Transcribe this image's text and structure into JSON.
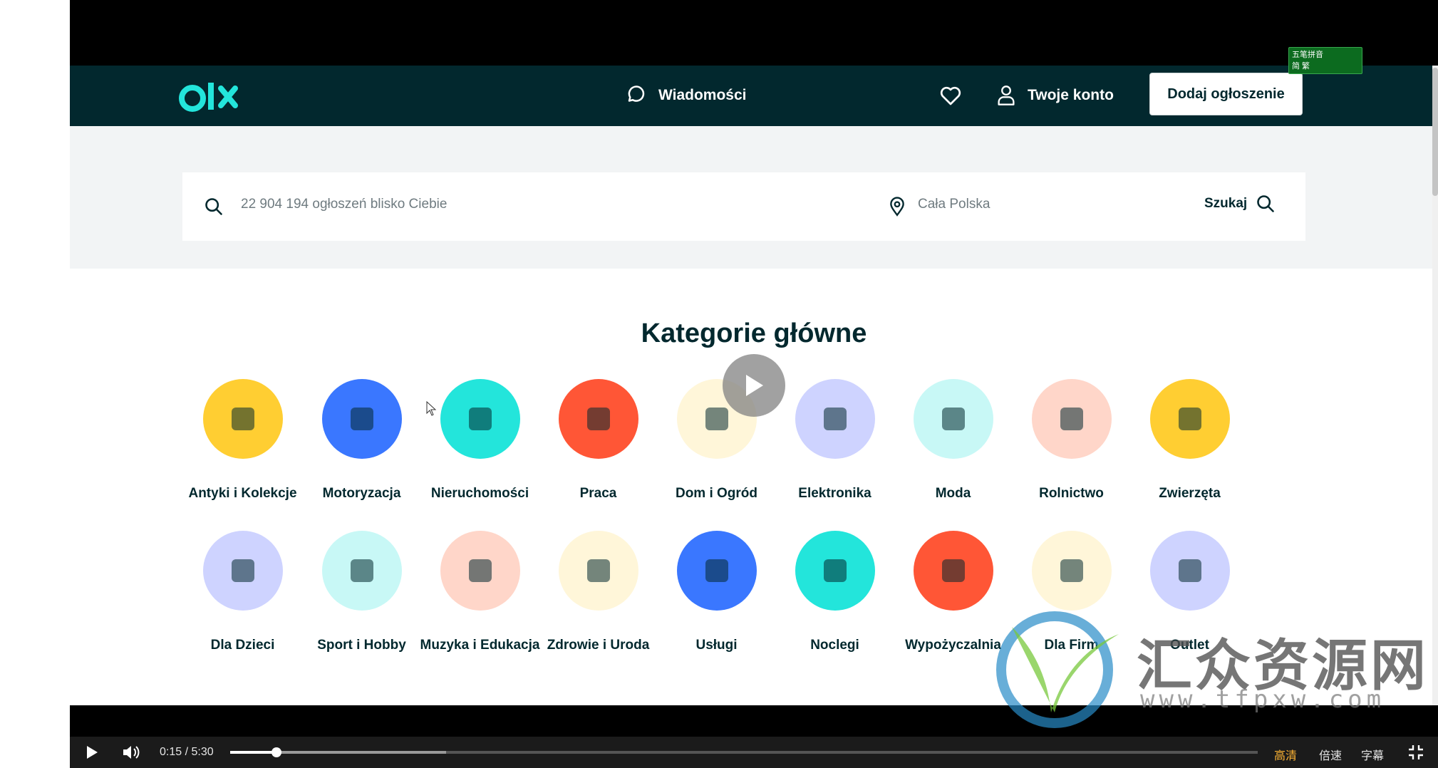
{
  "header": {
    "logo_text": "olx",
    "messages_label": "Wiadomości",
    "account_label": "Twoje konto",
    "add_listing_label": "Dodaj ogłoszenie"
  },
  "search": {
    "placeholder": "22 904 194 ogłoszeń blisko Ciebie",
    "location_placeholder": "Cała Polska",
    "button_label": "Szukaj"
  },
  "categories_title": "Kategorie główne",
  "categories": [
    {
      "label": "Antyki i Kolekcje",
      "icon": "pocket-watch-icon",
      "color": "#ffce32"
    },
    {
      "label": "Motoryzacja",
      "icon": "car-icon",
      "color": "#3a77ff"
    },
    {
      "label": "Nieruchomości",
      "icon": "key-icon",
      "color": "#23e5db"
    },
    {
      "label": "Praca",
      "icon": "briefcase-icon",
      "color": "#ff5636"
    },
    {
      "label": "Dom i Ogród",
      "icon": "chair-icon",
      "color": "#fff6d9"
    },
    {
      "label": "Elektronika",
      "icon": "phone-icon",
      "color": "#ced3ff"
    },
    {
      "label": "Moda",
      "icon": "dress-icon",
      "color": "#c8f8f6"
    },
    {
      "label": "Rolnictwo",
      "icon": "tractor-icon",
      "color": "#ffd6c9"
    },
    {
      "label": "Zwierzęta",
      "icon": "dog-icon",
      "color": "#ffce32"
    },
    {
      "label": "Dla Dzieci",
      "icon": "stroller-icon",
      "color": "#ced3ff"
    },
    {
      "label": "Sport i Hobby",
      "icon": "ball-icon",
      "color": "#c8f8f6"
    },
    {
      "label": "Muzyka i Edukacja",
      "icon": "guitar-icon",
      "color": "#ffd6c9"
    },
    {
      "label": "Zdrowie i Uroda",
      "icon": "perfume-icon",
      "color": "#fff6d9"
    },
    {
      "label": "Usługi",
      "icon": "paint-roller-icon",
      "color": "#3a77ff"
    },
    {
      "label": "Noclegi",
      "icon": "bed-icon",
      "color": "#23e5db"
    },
    {
      "label": "Wypożyczalnia",
      "icon": "calendar-icon",
      "color": "#ff5636"
    },
    {
      "label": "Dla Firm",
      "icon": "headphones-icon",
      "color": "#fff6d9"
    },
    {
      "label": "Outlet",
      "icon": "price-tag-icon",
      "color": "#ced3ff"
    }
  ],
  "player": {
    "current_time": "0:15",
    "separator": "/",
    "duration": "5:30",
    "progress": 0.045,
    "buffered": 0.21,
    "quality_label": "高清",
    "speed_label": "倍速",
    "subtitles_label": "字幕"
  },
  "ime": {
    "line1": "五笔拼音",
    "line2": "简 繁"
  },
  "watermark": {
    "text": "汇众资源网",
    "url": "www.tfpxw.com"
  },
  "colors": {
    "header_bg": "#02282e",
    "text_dark": "#02282e",
    "search_band": "#f2f4f5"
  }
}
